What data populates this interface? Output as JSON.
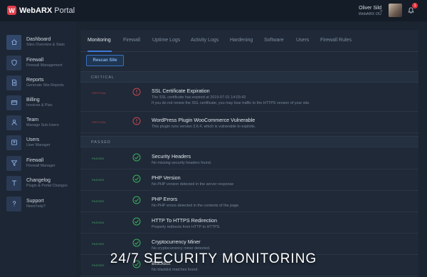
{
  "brand": {
    "name_bold": "WebARX",
    "name_rest": " Portal",
    "colors": {
      "accent": "#3d79d8",
      "critical": "#e0353f",
      "passed": "#3fae5f"
    }
  },
  "user": {
    "name": "Oliver Sild",
    "org": "WebARX OÜ",
    "notifications": "1"
  },
  "sidebar": {
    "items": [
      {
        "title": "Dashboard",
        "sub": "Sites Overview & Stats",
        "icon": "home-icon"
      },
      {
        "title": "Firewall",
        "sub": "Firewall Management",
        "icon": "shield-icon"
      },
      {
        "title": "Reports",
        "sub": "Generate Site Reports",
        "icon": "document-icon"
      },
      {
        "title": "Billing",
        "sub": "Invoices & Plan",
        "icon": "credit-card-icon"
      },
      {
        "title": "Team",
        "sub": "Manage Sub-Users",
        "icon": "team-icon"
      },
      {
        "title": "Users",
        "sub": "User Manager",
        "icon": "user-icon"
      },
      {
        "title": "Firewall",
        "sub": "Firewall Manager",
        "icon": "filter-icon"
      },
      {
        "title": "Changelog",
        "sub": "Plugin & Portal Changes",
        "icon": "changelog-icon"
      },
      {
        "title": "Support",
        "sub": "Need help?",
        "icon": "question-icon"
      }
    ]
  },
  "tabs": [
    "Monitoring",
    "Firewall",
    "Uptime Logs",
    "Activity Logs",
    "Hardening",
    "Software",
    "Users",
    "Firewall Rules"
  ],
  "rescan_label": "Rescan Site",
  "sections": {
    "critical": "CRITICAL",
    "passed": "PASSED"
  },
  "critical_items": [
    {
      "status": "CRITICAL",
      "title": "SSL Certificate Expiration",
      "desc": "The SSL certificate has expired at 2019-07-01 14:03:43",
      "desc2": "If you do not renew the SSL certificate, you may lose traffic to the HTTPS version of your site."
    },
    {
      "status": "CRITICAL",
      "title": "WordPress Plugin WooCommerce Vulnerable",
      "desc": "This plugin runs version 3.6.4, which is vulnerable to exploits."
    }
  ],
  "passed_items": [
    {
      "status": "PASSED",
      "title": "Security Headers",
      "desc": "No missing security headers found."
    },
    {
      "status": "PASSED",
      "title": "PHP Version",
      "desc": "No PHP version detected in the server response"
    },
    {
      "status": "PASSED",
      "title": "PHP Errors",
      "desc": "No PHP errors detected in the contents of the page."
    },
    {
      "status": "PASSED",
      "title": "HTTP To HTTPS Redirection",
      "desc": "Properly redirects from HTTP to HTTPS."
    },
    {
      "status": "PASSED",
      "title": "Cryptocurrency Miner",
      "desc": "No cryptocurrency miner detected."
    },
    {
      "status": "PASSED",
      "title": "Blacklist",
      "desc": "No blacklist matches found."
    }
  ],
  "caption": "24/7 SECURITY MONITORING"
}
